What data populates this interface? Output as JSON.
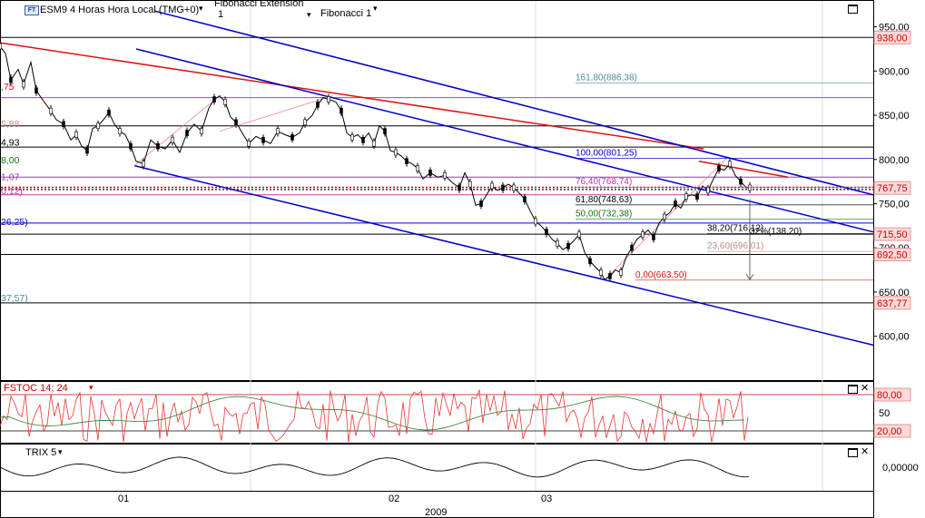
{
  "header": {
    "symbol": "ESM9 4 Horas Hora Local (TMG+0)",
    "study1": "Fibonacci Extension",
    "study1_value": "1",
    "study2": "Fibonacci 1",
    "ft_icon": "ft-icon"
  },
  "panels": {
    "stoch_label": "FSTOC 14; 24",
    "trix_label": "TRIX 5"
  },
  "colors": {
    "price": "#000000",
    "channel": "#0000cc",
    "trend_red": "#dd1111",
    "stoch_fast": "#ee3333",
    "stoch_slow": "#448844",
    "fib_pink": "#cc33aa",
    "fib_green": "#117711",
    "fib_teal": "#337788"
  },
  "chart_data": {
    "type": "line",
    "main": {
      "yaxis_ticks": [
        "950,00",
        "900,00",
        "850,00",
        "800,00",
        "750,00",
        "700,00",
        "650,00",
        "600,00"
      ],
      "ylim": [
        575,
        965
      ],
      "xaxis_labels": [
        "01",
        "02",
        "03"
      ],
      "year_label": "2009",
      "price_path": [
        [
          0,
          928
        ],
        [
          6,
          920
        ],
        [
          12,
          890
        ],
        [
          20,
          902
        ],
        [
          26,
          885
        ],
        [
          34,
          910
        ],
        [
          40,
          878
        ],
        [
          48,
          866
        ],
        [
          56,
          855
        ],
        [
          62,
          845
        ],
        [
          70,
          840
        ],
        [
          78,
          822
        ],
        [
          84,
          828
        ],
        [
          90,
          815
        ],
        [
          96,
          810
        ],
        [
          102,
          835
        ],
        [
          108,
          838
        ],
        [
          114,
          845
        ],
        [
          120,
          853
        ],
        [
          126,
          840
        ],
        [
          132,
          832
        ],
        [
          138,
          828
        ],
        [
          144,
          815
        ],
        [
          150,
          798
        ],
        [
          158,
          795
        ],
        [
          166,
          822
        ],
        [
          174,
          815
        ],
        [
          182,
          812
        ],
        [
          190,
          822
        ],
        [
          198,
          808
        ],
        [
          206,
          830
        ],
        [
          214,
          840
        ],
        [
          222,
          832
        ],
        [
          230,
          858
        ],
        [
          236,
          868
        ],
        [
          242,
          872
        ],
        [
          248,
          865
        ],
        [
          254,
          848
        ],
        [
          260,
          842
        ],
        [
          268,
          828
        ],
        [
          274,
          818
        ],
        [
          282,
          826
        ],
        [
          290,
          822
        ],
        [
          298,
          818
        ],
        [
          306,
          832
        ],
        [
          314,
          828
        ],
        [
          322,
          825
        ],
        [
          330,
          830
        ],
        [
          336,
          842
        ],
        [
          344,
          850
        ],
        [
          350,
          862
        ],
        [
          356,
          870
        ],
        [
          362,
          868
        ],
        [
          370,
          865
        ],
        [
          376,
          855
        ],
        [
          382,
          830
        ],
        [
          388,
          825
        ],
        [
          394,
          828
        ],
        [
          400,
          822
        ],
        [
          406,
          830
        ],
        [
          412,
          818
        ],
        [
          418,
          838
        ],
        [
          424,
          832
        ],
        [
          430,
          810
        ],
        [
          436,
          808
        ],
        [
          442,
          804
        ],
        [
          448,
          798
        ],
        [
          454,
          795
        ],
        [
          460,
          790
        ],
        [
          466,
          778
        ],
        [
          474,
          785
        ],
        [
          482,
          780
        ],
        [
          490,
          782
        ],
        [
          498,
          774
        ],
        [
          506,
          768
        ],
        [
          512,
          785
        ],
        [
          518,
          772
        ],
        [
          524,
          748
        ],
        [
          530,
          750
        ],
        [
          536,
          760
        ],
        [
          542,
          770
        ],
        [
          548,
          765
        ],
        [
          554,
          768
        ],
        [
          560,
          772
        ],
        [
          566,
          768
        ],
        [
          572,
          762
        ],
        [
          578,
          755
        ],
        [
          584,
          742
        ],
        [
          590,
          730
        ],
        [
          596,
          725
        ],
        [
          602,
          718
        ],
        [
          608,
          710
        ],
        [
          614,
          705
        ],
        [
          620,
          698
        ],
        [
          626,
          702
        ],
        [
          632,
          708
        ],
        [
          638,
          715
        ],
        [
          644,
          695
        ],
        [
          650,
          685
        ],
        [
          656,
          678
        ],
        [
          662,
          672
        ],
        [
          666,
          664
        ],
        [
          672,
          668
        ],
        [
          678,
          675
        ],
        [
          684,
          672
        ],
        [
          690,
          690
        ],
        [
          696,
          700
        ],
        [
          702,
          710
        ],
        [
          708,
          715
        ],
        [
          714,
          720
        ],
        [
          720,
          712
        ],
        [
          726,
          728
        ],
        [
          732,
          735
        ],
        [
          738,
          740
        ],
        [
          744,
          750
        ],
        [
          750,
          745
        ],
        [
          756,
          758
        ],
        [
          762,
          760
        ],
        [
          768,
          758
        ],
        [
          774,
          770
        ],
        [
          780,
          765
        ],
        [
          786,
          778
        ],
        [
          792,
          790
        ],
        [
          798,
          788
        ],
        [
          804,
          795
        ],
        [
          810,
          782
        ],
        [
          816,
          775
        ],
        [
          822,
          768
        ],
        [
          826,
          768
        ]
      ],
      "trendlines": [
        {
          "color": "red",
          "from": [
            0,
            932
          ],
          "to": [
            775,
            812
          ]
        },
        {
          "color": "red",
          "from": [
            770,
            798
          ],
          "to": [
            868,
            780
          ]
        },
        {
          "color": "blue",
          "from": [
            150,
            925
          ],
          "to": [
            962,
            718
          ]
        },
        {
          "color": "blue",
          "from": [
            170,
            968
          ],
          "to": [
            962,
            760
          ]
        },
        {
          "color": "blue",
          "from": [
            148,
            793
          ],
          "to": [
            962,
            590
          ]
        },
        {
          "color": "red-thin",
          "from": [
            148,
            793
          ],
          "to": [
            242,
            872
          ]
        },
        {
          "color": "red-thin",
          "from": [
            242,
            832
          ],
          "to": [
            366,
            872
          ]
        },
        {
          "color": "red-thin",
          "from": [
            666,
            664
          ],
          "to": [
            800,
            801
          ]
        }
      ],
      "horizontal_levels": [
        {
          "value": 938,
          "color": "black"
        },
        {
          "value": 870,
          "color": "pink"
        },
        {
          "value": 838,
          "color": "black"
        },
        {
          "value": 814,
          "color": "black"
        },
        {
          "value": 780,
          "color": "purple"
        },
        {
          "value": 768.5,
          "color": "red-dotted"
        },
        {
          "value": 766,
          "color": "black-dotted"
        },
        {
          "value": 760,
          "color": "pink"
        },
        {
          "value": 728,
          "color": "blue"
        },
        {
          "value": 715.5,
          "color": "black"
        },
        {
          "value": 692.5,
          "color": "black"
        },
        {
          "value": 637.77,
          "color": "black"
        }
      ],
      "fib_levels": [
        {
          "label": "161,80(886,38)",
          "value": 886.38,
          "color": "teal"
        },
        {
          "label": "100,00(801,25)",
          "value": 801.25,
          "color": "blue"
        },
        {
          "label": "76,40(768,74)",
          "value": 768.74,
          "color": "pink"
        },
        {
          "label": "61,80(748,63)",
          "value": 748.63,
          "color": "black"
        },
        {
          "label": "50,00(732,38)",
          "value": 732.38,
          "color": "green"
        },
        {
          "label": "38,20(716,12)",
          "value": 716.12,
          "color": "black"
        },
        {
          "label": "23,60(696,01)",
          "value": 696.01,
          "color": "pinkgray"
        },
        {
          "label": "0,00(663,50)",
          "value": 663.5,
          "color": "red"
        }
      ],
      "annotation": "32%(138,20)",
      "left_labels": [
        {
          "text": ",75",
          "value": 883,
          "color": "red"
        },
        {
          "text": "5,88",
          "value": 841,
          "color": "pinkgray"
        },
        {
          "text": "4,93",
          "value": 820,
          "color": "black"
        },
        {
          "text": "8,00",
          "value": 800,
          "color": "green"
        },
        {
          "text": "1,07",
          "value": 781,
          "color": "purple"
        },
        {
          "text": "0,12)",
          "value": 765,
          "color": "pink"
        },
        {
          "text": "26,25)",
          "value": 730,
          "color": "blue"
        },
        {
          "text": "37,57)",
          "value": 644,
          "color": "teal"
        }
      ],
      "price_tags": [
        {
          "text": "938,00",
          "value": 938
        },
        {
          "text": "767,75",
          "value": 767.75
        },
        {
          "text": "715,50",
          "value": 715.5
        },
        {
          "text": "692,50",
          "value": 692.5
        },
        {
          "text": "637,77",
          "value": 637.77
        }
      ]
    },
    "stochastic": {
      "yaxis_ticks": [
        "50"
      ],
      "levels": [
        "80,00",
        "20,00"
      ]
    },
    "trix": {
      "yaxis_ticks": [
        "0,00000"
      ]
    }
  }
}
